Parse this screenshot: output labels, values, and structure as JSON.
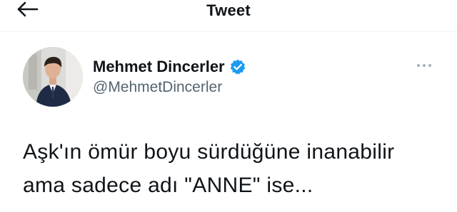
{
  "header": {
    "title": "Tweet",
    "back_icon": "arrow-left-icon"
  },
  "tweet": {
    "author": {
      "display_name": "Mehmet Dincerler",
      "handle": "@MehmetDincerler",
      "verified": true,
      "verified_icon": "verified-badge-icon",
      "verified_color": "#1d9bf0"
    },
    "more_icon": "more-options-icon",
    "text_lines": [
      "Aşk'ın ömür boyu sürdüğüne inanabilir",
      "ama sadece adı \"ANNE\" ise..."
    ]
  },
  "colors": {
    "text_primary": "#0f1419",
    "text_secondary": "#536471",
    "accent": "#1d9bf0"
  }
}
